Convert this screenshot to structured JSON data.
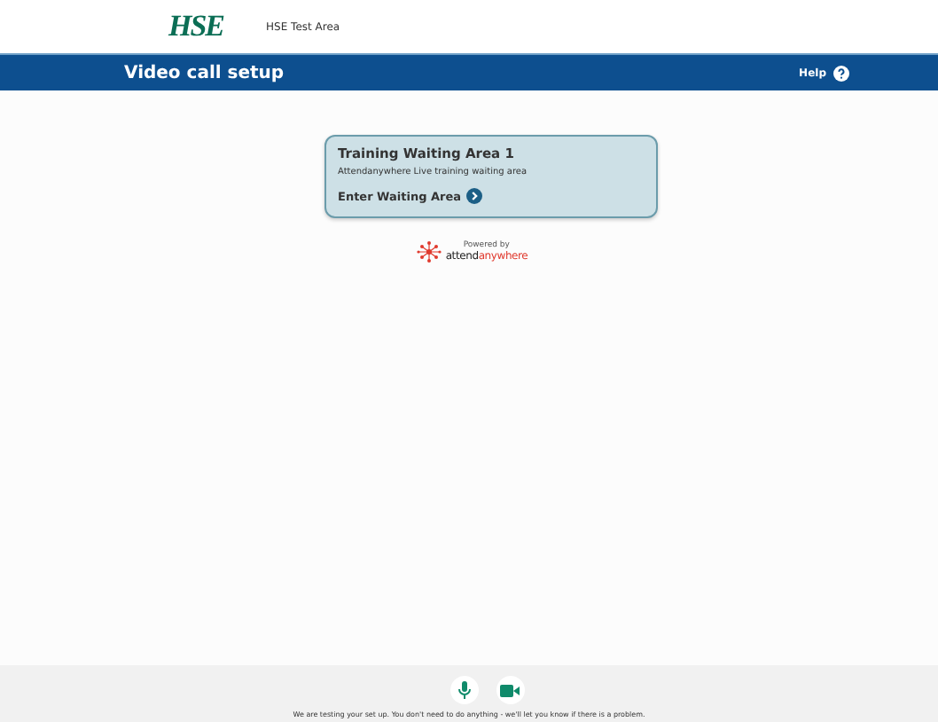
{
  "header": {
    "logo": "HSE",
    "site_name": "HSE Test Area"
  },
  "title_bar": {
    "title": "Video call setup",
    "help": "Help"
  },
  "waiting_area": {
    "title": "Training Waiting Area 1",
    "description": "Attendanywhere Live training waiting area",
    "link": "Enter Waiting Area"
  },
  "powered_by": {
    "label": "Powered by",
    "brand_start": "attend",
    "brand_end": "anywhere"
  },
  "footer": {
    "message": "We are testing your set up. You don't need to do anything - we'll let you know if there is a problem."
  }
}
